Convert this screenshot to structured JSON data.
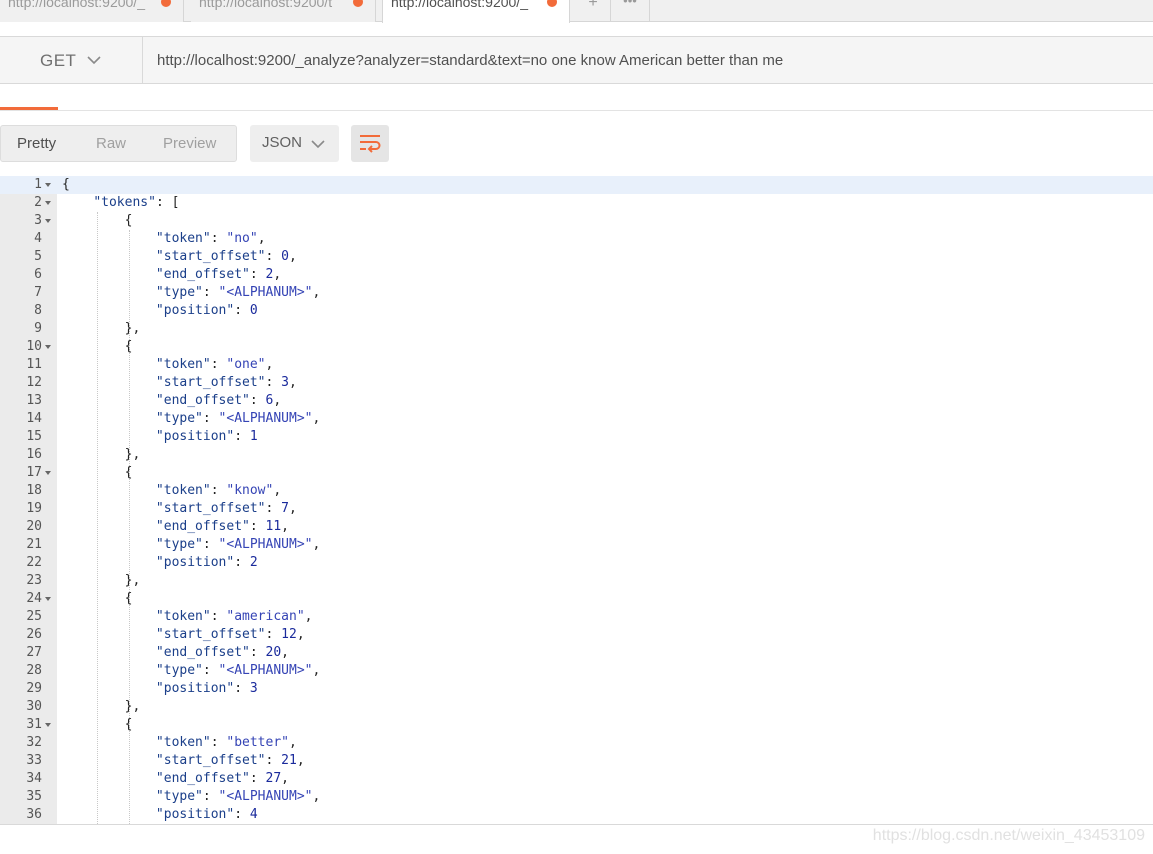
{
  "tabs": [
    {
      "label": "http://localhost:9200/_",
      "active": false
    },
    {
      "label": "http://localhost:9200/t",
      "active": false
    },
    {
      "label": "http://localhost:9200/_",
      "active": true
    }
  ],
  "tab_actions": {
    "add": "+",
    "more": "•••"
  },
  "request": {
    "method": "GET",
    "url": "http://localhost:9200/_analyze?analyzer=standard&text=no one know American better than me"
  },
  "response": {
    "views": [
      "Pretty",
      "Raw",
      "Preview"
    ],
    "active_view": "Pretty",
    "format": "JSON"
  },
  "code_lines": [
    "{",
    "    \"tokens\": [",
    "        {",
    "            \"token\": \"no\",",
    "            \"start_offset\": 0,",
    "            \"end_offset\": 2,",
    "            \"type\": \"<ALPHANUM>\",",
    "            \"position\": 0",
    "        },",
    "        {",
    "            \"token\": \"one\",",
    "            \"start_offset\": 3,",
    "            \"end_offset\": 6,",
    "            \"type\": \"<ALPHANUM>\",",
    "            \"position\": 1",
    "        },",
    "        {",
    "            \"token\": \"know\",",
    "            \"start_offset\": 7,",
    "            \"end_offset\": 11,",
    "            \"type\": \"<ALPHANUM>\",",
    "            \"position\": 2",
    "        },",
    "        {",
    "            \"token\": \"american\",",
    "            \"start_offset\": 12,",
    "            \"end_offset\": 20,",
    "            \"type\": \"<ALPHANUM>\",",
    "            \"position\": 3",
    "        },",
    "        {",
    "            \"token\": \"better\",",
    "            \"start_offset\": 21,",
    "            \"end_offset\": 27,",
    "            \"type\": \"<ALPHANUM>\",",
    "            \"position\": 4"
  ],
  "foldable_lines": [
    1,
    2,
    3,
    10,
    17,
    24,
    31
  ],
  "highlighted_line": 1,
  "watermark": "https://blog.csdn.net/weixin_43453109",
  "colors": {
    "accent": "#f26b3a",
    "key": "#1b3f8a",
    "string": "#3544b5"
  }
}
